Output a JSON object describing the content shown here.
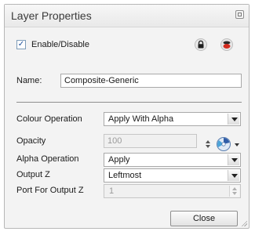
{
  "window": {
    "title": "Layer Properties",
    "restore_icon": "restore-window-icon"
  },
  "enable": {
    "checked": true,
    "check_mark": "✓",
    "label": "Enable/Disable",
    "lock_icon": "lock-icon",
    "color_icon": "layer-color-icon"
  },
  "name": {
    "label": "Name:",
    "value": "Composite-Generic"
  },
  "fields": {
    "colour_operation": {
      "label": "Colour Operation",
      "value": "Apply With Alpha"
    },
    "opacity": {
      "label": "Opacity",
      "value": "100"
    },
    "alpha_operation": {
      "label": "Alpha Operation",
      "value": "Apply"
    },
    "output_z": {
      "label": "Output Z",
      "value": "Leftmost"
    },
    "port_for_output_z": {
      "label": "Port For Output Z",
      "value": "1"
    }
  },
  "buttons": {
    "close": "Close"
  },
  "colors": {
    "panel_bg": "#f3f3f3",
    "border": "#b7b7b7",
    "check_color": "#1a4d9a"
  }
}
